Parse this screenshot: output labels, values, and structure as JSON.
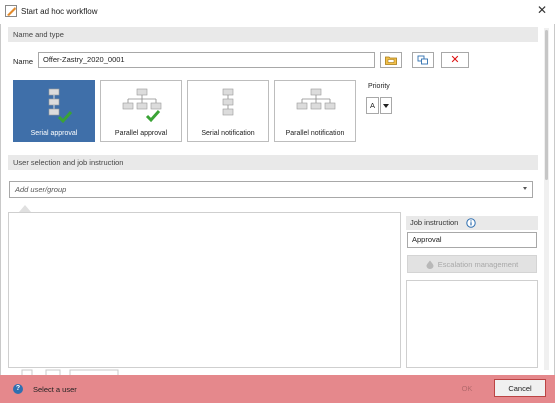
{
  "window": {
    "title": "Start ad hoc workflow"
  },
  "name_type": {
    "header": "Name and type",
    "name_label": "Name",
    "name_value": "Offer-Zastry_2020_0001"
  },
  "workflow_types": [
    {
      "label": "Serial approval",
      "selected": true
    },
    {
      "label": "Parallel approval",
      "selected": false
    },
    {
      "label": "Serial notification",
      "selected": false
    },
    {
      "label": "Parallel notification",
      "selected": false
    }
  ],
  "priority": {
    "label": "Priority",
    "value": "A"
  },
  "user_section": {
    "header": "User selection and job instruction",
    "add_user_placeholder": "Add user/group"
  },
  "job": {
    "label": "Job instruction",
    "value": "Approval",
    "escalation_label": "Escalation management"
  },
  "status": {
    "text": "Select a user",
    "ok_label": "OK",
    "cancel_label": "Cancel"
  },
  "colors": {
    "selected_tile": "#3f6fa9",
    "status_bar": "#e5888c",
    "check_green": "#3aa335"
  },
  "icons": [
    "app-icon",
    "folder-icon",
    "copy-icon",
    "delete-icon",
    "serial-approval-icon",
    "parallel-approval-icon",
    "serial-notification-icon",
    "parallel-notification-icon",
    "chevron-down-icon",
    "info-icon",
    "escalation-icon",
    "help-icon"
  ]
}
